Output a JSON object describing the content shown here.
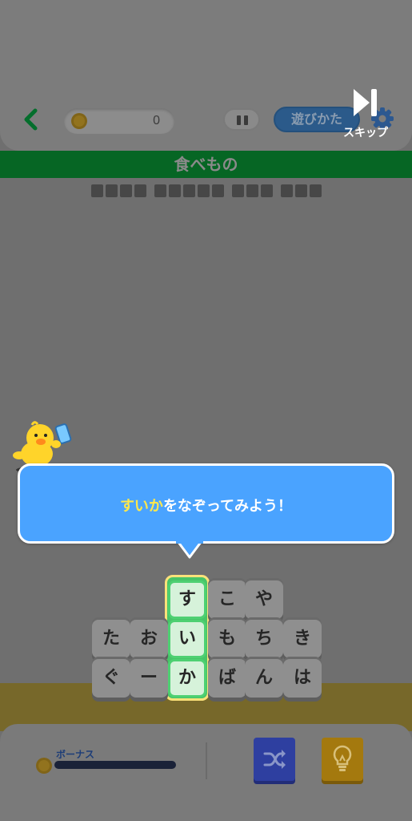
{
  "header": {
    "coin_count": "0",
    "howto_label": "遊びかた",
    "skip_label": "スキップ"
  },
  "category": {
    "title": "食べもの"
  },
  "hidden_words": [
    4,
    5,
    3,
    3
  ],
  "tutorial": {
    "highlight": "すいか",
    "message": "をなぞってみよう！"
  },
  "board": {
    "tiles": [
      [
        "す",
        "こ",
        "や"
      ],
      [
        "た",
        "お",
        "い",
        "も",
        "ち",
        "き"
      ],
      [
        "ぐ",
        "ー",
        "か",
        "ば",
        "ん",
        "は"
      ]
    ]
  },
  "bottom": {
    "bonus_label": "ボーナス",
    "bonus_progress": 0
  },
  "colors": {
    "category_bar": "#066624",
    "bubble": "#4aa3ff",
    "highlight_text": "#ffe84a",
    "selected_tile": "#47c468",
    "shuffle_button": "#2e3fa0",
    "hint_button": "#a4790e"
  },
  "icons": [
    "back-arrow-icon",
    "coin-icon",
    "pause-icon",
    "gear-icon",
    "skip-icon",
    "shuffle-icon",
    "lightbulb-icon"
  ]
}
